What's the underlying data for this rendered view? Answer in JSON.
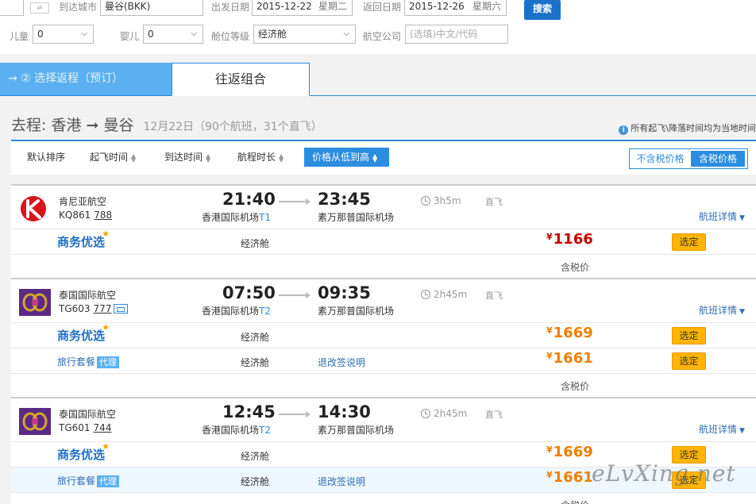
{
  "search": {
    "arrive_label": "到达城市",
    "arrive_value": "曼谷(BKK)",
    "depart_date_label": "出发日期",
    "depart_date": "2015-12-22",
    "depart_weekday": "星期二",
    "return_date_label": "返回日期",
    "return_date": "2015-12-26",
    "return_weekday": "星期六",
    "search_button": "搜索",
    "child_label": "儿童",
    "child_value": "0",
    "infant_label": "婴儿",
    "infant_value": "0",
    "cabin_label": "舱位等级",
    "cabin_value": "经济舱",
    "airline_label": "航空公司",
    "airline_placeholder": "(选填)中文/代码"
  },
  "tabs": {
    "step": "→ ② 选择返程（预订）",
    "combo": "往返组合"
  },
  "route": {
    "title": "去程:  香港 ➞ 曼谷",
    "info": "12月22日（90个航班，31个直飞）",
    "note": "所有起飞\\降落时间均为当地时间"
  },
  "sort": {
    "default": "默认排序",
    "depart": "起飞时间",
    "arrive": "到达时间",
    "duration": "航程时长",
    "price": "价格从低到高",
    "no_tax": "不含税价格",
    "with_tax": "含税价格"
  },
  "common": {
    "detail_link": "航班详情",
    "direct": "直飞",
    "select": "选定",
    "tax_note": "含税价",
    "business": "商务优选",
    "package": "旅行套餐",
    "agent": "代理",
    "rules": "退改签说明",
    "currency": "¥"
  },
  "flights": [
    {
      "airline": "肯尼亚航空",
      "flight_no": "KQ861",
      "plane": "788",
      "dep_time": "21:40",
      "arr_time": "23:45",
      "dep_airport": "香港国际机场",
      "dep_terminal": "T1",
      "arr_airport": "素万那普国际机场",
      "duration": "3h5m",
      "fares": [
        {
          "cabin": "经济舱",
          "price": "1166"
        }
      ]
    },
    {
      "airline": "泰国国际航空",
      "flight_no": "TG603",
      "plane": "777",
      "dep_time": "07:50",
      "arr_time": "09:35",
      "dep_airport": "香港国际机场",
      "dep_terminal": "T2",
      "arr_airport": "素万那普国际机场",
      "duration": "2h45m",
      "fares": [
        {
          "cabin": "经济舱",
          "price": "1669"
        },
        {
          "cabin": "经济舱",
          "price": "1661"
        }
      ]
    },
    {
      "airline": "泰国国际航空",
      "flight_no": "TG601",
      "plane": "744",
      "dep_time": "12:45",
      "arr_time": "14:30",
      "dep_airport": "香港国际机场",
      "dep_terminal": "T2",
      "arr_airport": "素万那普国际机场",
      "duration": "2h45m",
      "fares": [
        {
          "cabin": "经济舱",
          "price": "1669"
        },
        {
          "cabin": "经济舱",
          "price": "1661"
        }
      ]
    }
  ],
  "watermark": "eLvXing.net"
}
